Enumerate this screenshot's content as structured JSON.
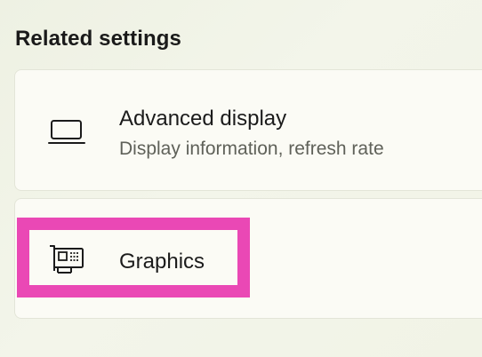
{
  "section": {
    "title": "Related settings"
  },
  "items": [
    {
      "icon": "laptop-icon",
      "title": "Advanced display",
      "subtitle": "Display information, refresh rate"
    },
    {
      "icon": "graphics-card-icon",
      "title": "Graphics"
    }
  ],
  "colors": {
    "highlight": "#ea48b5",
    "card_background": "#fbfbf5",
    "subtitle_text": "#5f6159"
  }
}
